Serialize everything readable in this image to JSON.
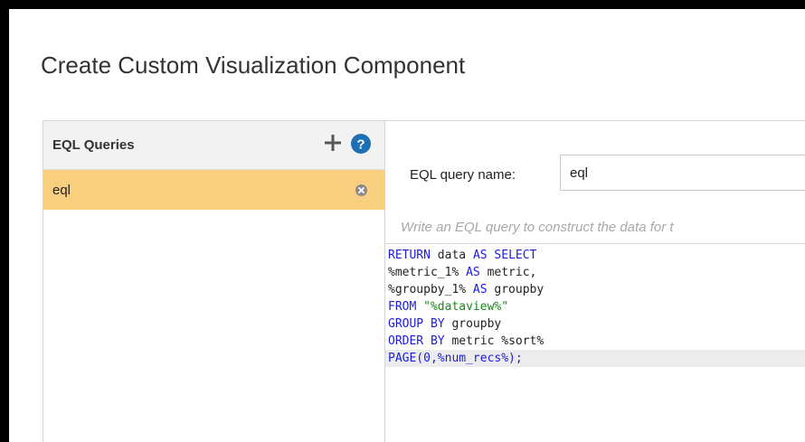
{
  "dialog": {
    "title": "Create Custom Visualization Component"
  },
  "queries_panel": {
    "header_label": "EQL Queries",
    "add_icon": "plus-icon",
    "help_icon": "question-circle-icon",
    "items": [
      {
        "label": "eql",
        "selected": true,
        "remove_icon": "remove-circle-icon"
      }
    ],
    "selected_color": "#f8cf7e"
  },
  "query_editor": {
    "name_label": "EQL query name:",
    "name_value": "eql",
    "hint": "Write an EQL query to construct the data for t",
    "code_lines": [
      {
        "tokens": [
          {
            "t": "RETURN",
            "k": "kw"
          },
          {
            "t": " data ",
            "k": ""
          },
          {
            "t": "AS SELECT",
            "k": "kw"
          }
        ]
      },
      {
        "tokens": [
          {
            "t": "%metric_1% ",
            "k": ""
          },
          {
            "t": "AS",
            "k": "kw"
          },
          {
            "t": " metric,",
            "k": ""
          }
        ]
      },
      {
        "tokens": [
          {
            "t": "%groupby_1% ",
            "k": ""
          },
          {
            "t": "AS",
            "k": "kw"
          },
          {
            "t": " groupby",
            "k": ""
          }
        ]
      },
      {
        "tokens": [
          {
            "t": "FROM",
            "k": "kw"
          },
          {
            "t": " ",
            "k": ""
          },
          {
            "t": "\"%dataview%\"",
            "k": "str"
          }
        ]
      },
      {
        "tokens": [
          {
            "t": "GROUP BY",
            "k": "kw"
          },
          {
            "t": " groupby",
            "k": ""
          }
        ]
      },
      {
        "tokens": [
          {
            "t": "ORDER BY",
            "k": "kw"
          },
          {
            "t": " metric %sort%",
            "k": ""
          }
        ]
      },
      {
        "tokens": [
          {
            "t": "PAGE(0,%num_recs%);",
            "k": "kw"
          }
        ],
        "active": true
      }
    ],
    "keyword_color": "#1c1ce0",
    "string_color": "#1a8a1a"
  }
}
